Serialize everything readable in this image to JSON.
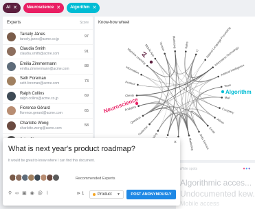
{
  "filters": [
    {
      "label": "AI",
      "color": "#5c1e3e"
    },
    {
      "label": "Neuroscience",
      "color": "#e91e63"
    },
    {
      "label": "Algorithm",
      "color": "#00bcd4"
    }
  ],
  "experts": {
    "title": "Experts",
    "score_label": "Score",
    "rows": [
      {
        "name": "Tarsely Jánes",
        "email": "tarsely.janes@acme.co.jp",
        "score": "97",
        "avatar": "#7a5c4a"
      },
      {
        "name": "Claudia Smith",
        "email": "claudia.smith@acme.com",
        "score": "91",
        "avatar": "#8c6e5d"
      },
      {
        "name": "Emilia Zimmermann",
        "email": "emilia.zimmermann@acme.com",
        "score": "88",
        "avatar": "#5e6c7a"
      },
      {
        "name": "Seth Foreman",
        "email": "seth.foreman@acme.com",
        "score": "73",
        "avatar": "#a08060"
      },
      {
        "name": "Ralph Collins",
        "email": "ralph.collins@acme.co.jp",
        "score": "69",
        "avatar": "#3e4a55"
      },
      {
        "name": "Florence Gérard",
        "email": "florence.gerard@acme.com",
        "score": "65",
        "avatar": "#b88d72"
      },
      {
        "name": "Charlotte Wong",
        "email": "charlotte.wong@acme.com",
        "score": "58",
        "avatar": "#6a4a40"
      },
      {
        "name": "John Cleese",
        "email": "",
        "score": "",
        "avatar": "#5a5a5a"
      }
    ]
  },
  "wheel": {
    "title": "Know-how wheel",
    "highlight_ai": "AI",
    "highlight_algorithm": "Algorithm",
    "highlight_neuroscience": "Neuroscience",
    "labels_left": [
      "Clients",
      "Product",
      "Information",
      "Machine Learning",
      "Mobile App",
      "Version",
      "Marketing"
    ],
    "labels_top": [
      "Sales",
      "IT",
      "Natural Language Processing",
      "Information Technology"
    ],
    "labels_right": [
      "Artificial Intelligence",
      "Team",
      "Mail",
      "Company",
      "Admin",
      "Email",
      "Data Science",
      "Marketing",
      "Research",
      "Search",
      "Mining"
    ],
    "labels_bottom": [
      "Customer",
      "Question",
      "Analytics"
    ]
  },
  "white_spots": {
    "title": "White spots",
    "line1": "Algorithmic acces...",
    "line2": "Undocumented kew...",
    "line3": "Mobile access"
  },
  "dialog": {
    "close": "×",
    "question": "What is next year's product roadmap?",
    "subtitle": "It would be great to know where I can find this document.",
    "recommended": "Recommended Experts",
    "count": "1",
    "product": "Product",
    "post": "POST ANONYMOUSLY"
  }
}
